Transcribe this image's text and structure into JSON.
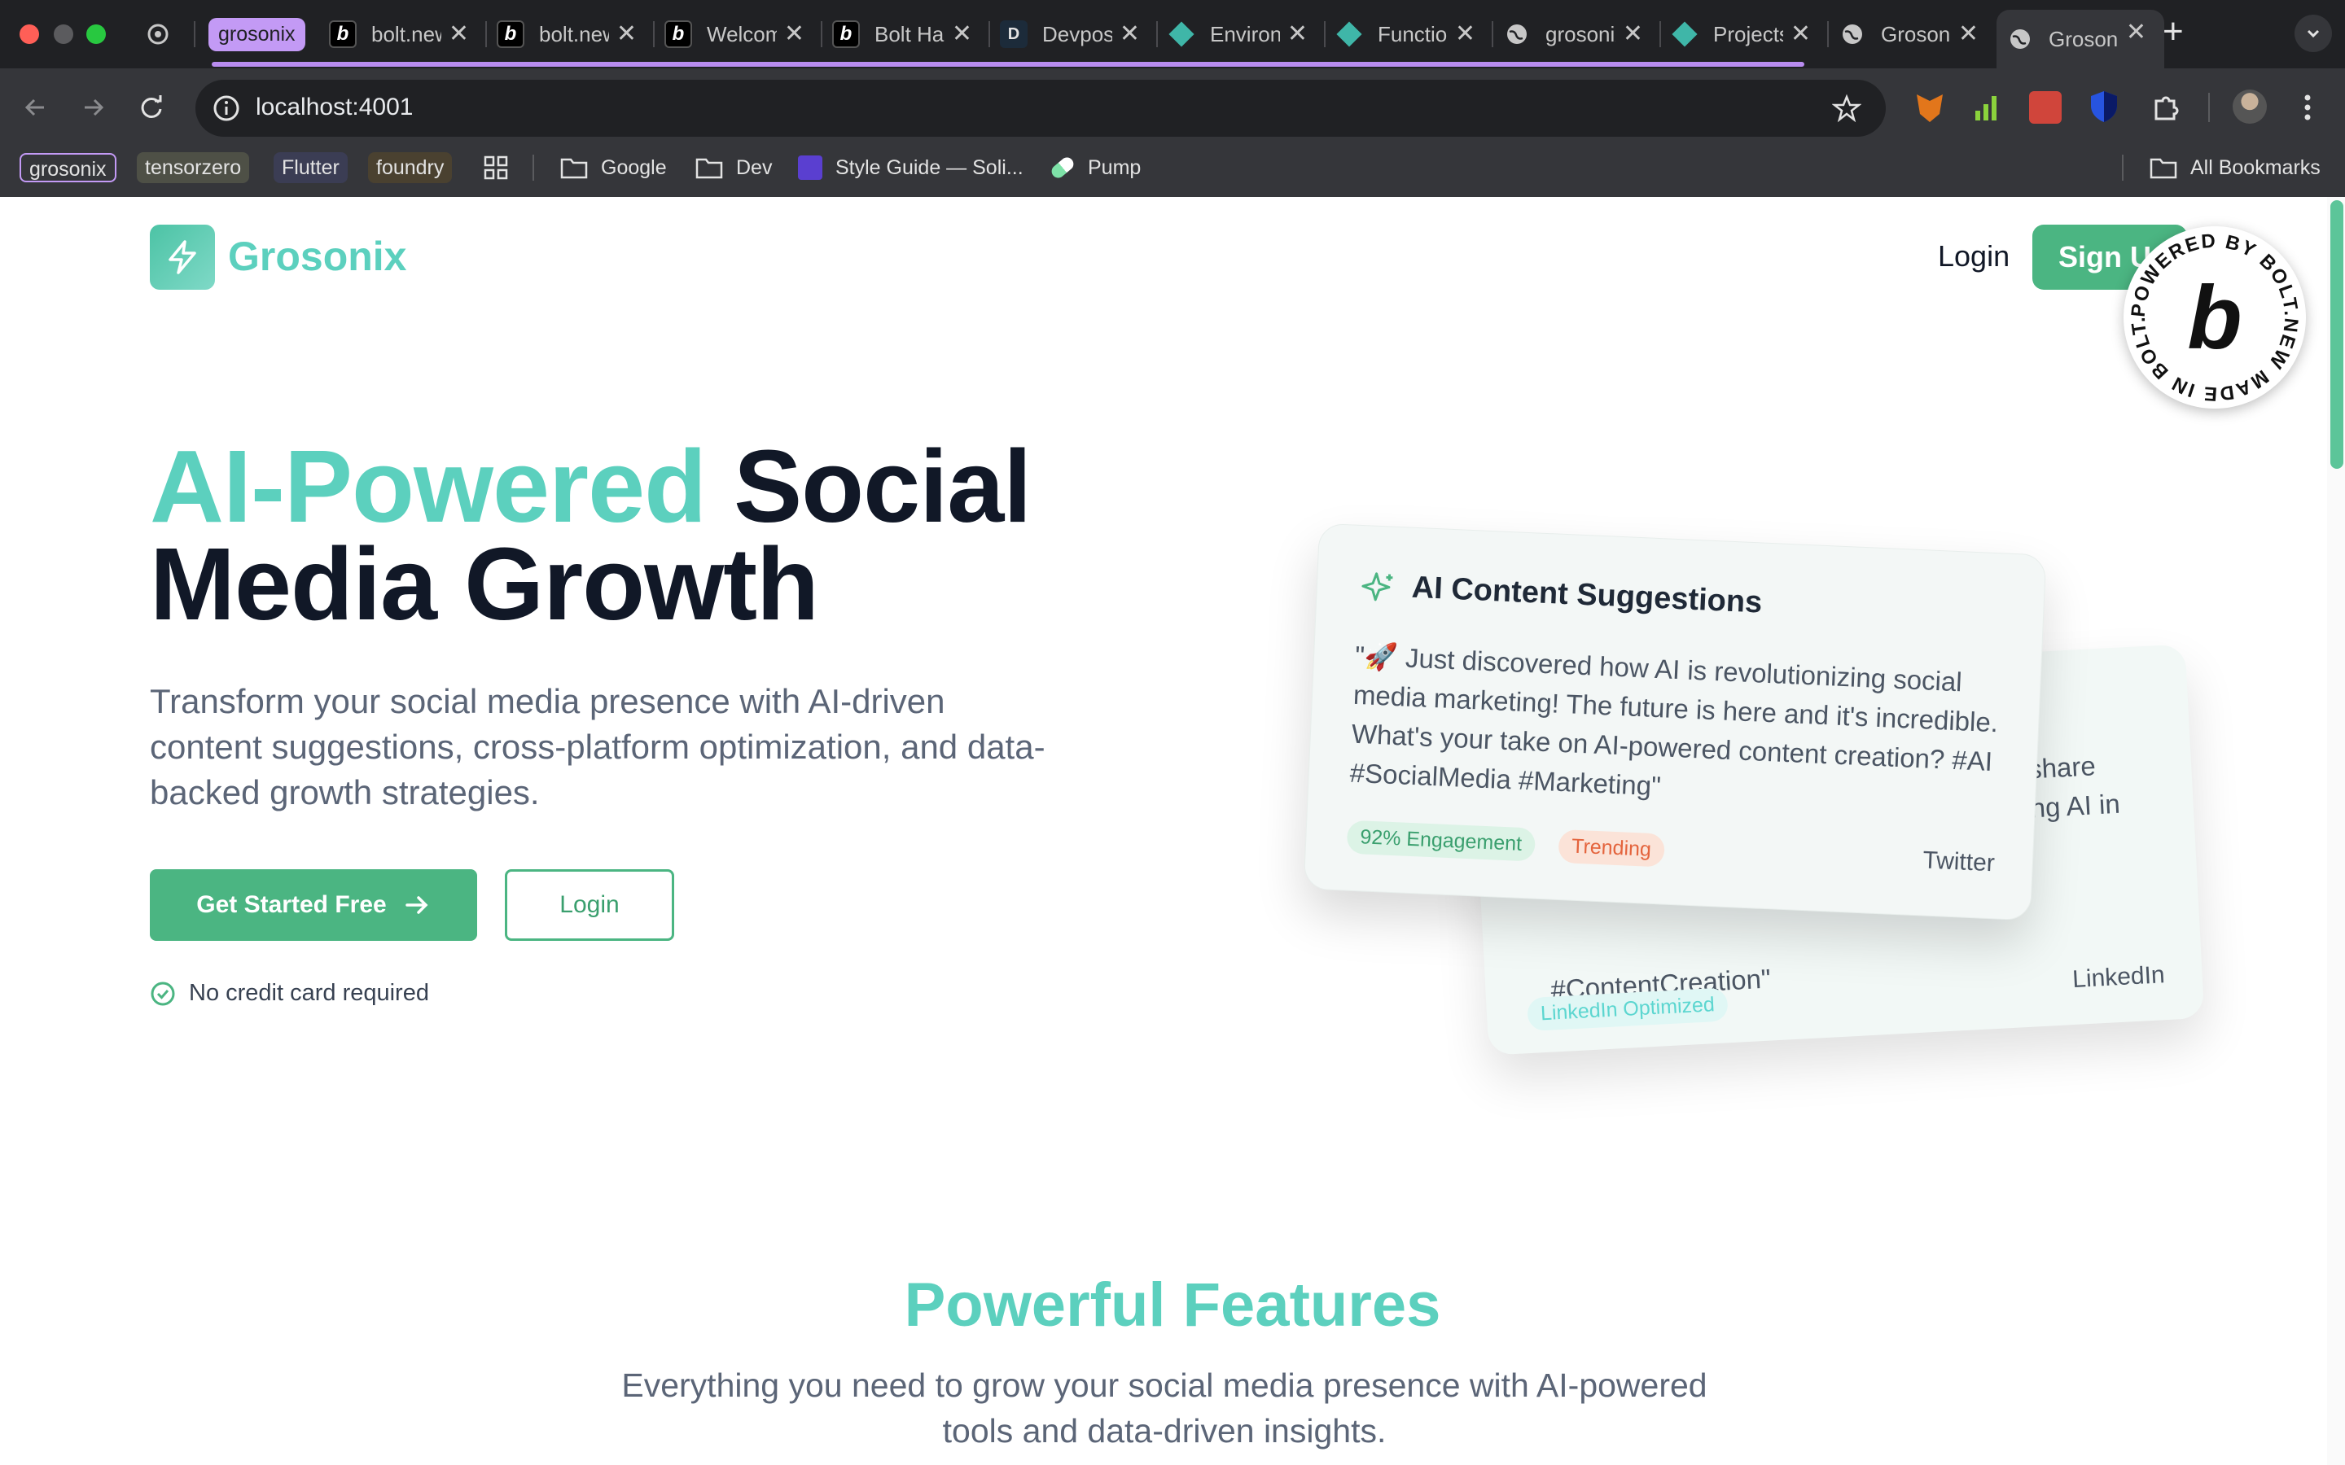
{
  "browser": {
    "pinned_tab_icon": "openai-icon",
    "tab_group_label": "grosonix",
    "tabs": [
      {
        "title": "bolt.new",
        "icon": "bolt-icon"
      },
      {
        "title": "bolt.new",
        "icon": "bolt-icon"
      },
      {
        "title": "Welcome",
        "icon": "bolt-icon"
      },
      {
        "title": "Bolt Hackathon",
        "icon": "bolt-icon"
      },
      {
        "title": "Devpost",
        "icon": "devpost-icon"
      },
      {
        "title": "Environment",
        "icon": "supabase-icon"
      },
      {
        "title": "Functions",
        "icon": "supabase-icon"
      },
      {
        "title": "grosonix",
        "icon": "globe-icon"
      },
      {
        "title": "Projects",
        "icon": "supabase-icon"
      },
      {
        "title": "Grosonix",
        "icon": "globe-icon"
      },
      {
        "title": "Grosonix",
        "icon": "globe-icon",
        "active": true
      }
    ],
    "close_glyph": "✕",
    "new_tab_glyph": "+",
    "url": "localhost:4001",
    "bookmarks": [
      {
        "label": "grosonix",
        "kind": "tag"
      },
      {
        "label": "tensorzero",
        "kind": "tag"
      },
      {
        "label": "Flutter",
        "kind": "tag"
      },
      {
        "label": "foundry",
        "kind": "tag"
      },
      {
        "label": "Google",
        "kind": "folder"
      },
      {
        "label": "Dev",
        "kind": "folder"
      },
      {
        "label": "Style Guide — Soli...",
        "kind": "link"
      },
      {
        "label": "Pump",
        "kind": "link"
      }
    ],
    "all_bookmarks": "All Bookmarks"
  },
  "site": {
    "brand": "Grosonix",
    "nav": {
      "login": "Login",
      "signup": "Sign Up"
    },
    "badge_text": "POWERED BY BOLT.NEW MADE IN BOLT.NEW ",
    "hero": {
      "title_accent": "AI-Powered",
      "title_rest": " Social",
      "title_line2": "Media Growth",
      "subtitle": "Transform your social media presence with AI-driven content suggestions, cross-platform optimization, and data-backed growth strategies.",
      "cta_primary": "Get Started Free",
      "cta_secondary": "Login",
      "note": "No credit card required"
    },
    "card_front": {
      "title": "AI Content Suggestions",
      "body": "\"🚀 Just discovered how AI is revolutionizing social media marketing! The future is here and it's incredible. What's your take on AI-powered content creation? #AI #SocialMedia #Marketing\"",
      "tag1": "92% Engagement",
      "tag2": "Trending",
      "platform": "Twitter"
    },
    "card_back": {
      "line1": "share",
      "line2": "ng AI in",
      "line3": "#ContentCreation\"",
      "tag": "LinkedIn Optimized",
      "platform": "LinkedIn"
    },
    "features": {
      "title": "Powerful Features",
      "subtitle": "Everything you need to grow your social media presence with AI-powered tools and data-driven insights."
    }
  },
  "colors": {
    "brand_teal": "#5cd0be",
    "brand_green": "#4bb582",
    "chrome_dark": "#202124",
    "chrome_toolbar": "#35363a"
  }
}
